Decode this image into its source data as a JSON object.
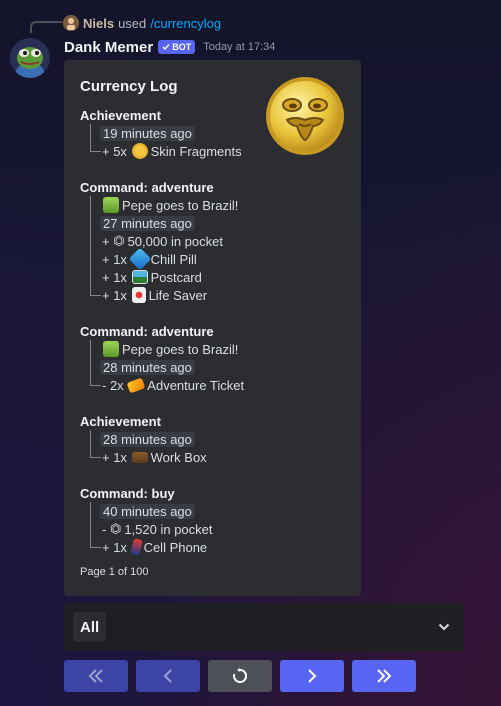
{
  "reply": {
    "user": "Niels",
    "used_text": "used",
    "command": "/currencylog"
  },
  "message": {
    "author": "Dank Memer",
    "badge": "BOT",
    "timestamp": "Today at 17:34"
  },
  "embed": {
    "title": "Currency Log",
    "thumbnail_icon": "pepe-coin-icon",
    "footer": "Page 1 of 100",
    "entries": [
      {
        "title": "Achievement",
        "time": "19 minutes ago",
        "lines": [
          {
            "prefix": "+ 5x",
            "icon": "skin-fragments-icon",
            "text": "Skin Fragments"
          }
        ]
      },
      {
        "title": "Command: adventure",
        "note": {
          "icon": "drink-icon",
          "text": "Pepe goes to Brazil!"
        },
        "time": "27 minutes ago",
        "lines": [
          {
            "prefix": "+",
            "icon": "coin-icon",
            "text": "50,000 in pocket"
          },
          {
            "prefix": "+ 1x",
            "icon": "chill-pill-icon",
            "text": "Chill Pill"
          },
          {
            "prefix": "+ 1x",
            "icon": "postcard-icon",
            "text": "Postcard"
          },
          {
            "prefix": "+ 1x",
            "icon": "life-saver-icon",
            "text": "Life Saver"
          }
        ]
      },
      {
        "title": "Command: adventure",
        "note": {
          "icon": "drink-icon",
          "text": "Pepe goes to Brazil!"
        },
        "time": "28 minutes ago",
        "lines": [
          {
            "prefix": "- 2x",
            "icon": "adventure-ticket-icon",
            "text": "Adventure Ticket"
          }
        ]
      },
      {
        "title": "Achievement",
        "time": "28 minutes ago",
        "lines": [
          {
            "prefix": "+ 1x",
            "icon": "work-box-icon",
            "text": "Work Box"
          }
        ]
      },
      {
        "title": "Command: buy",
        "time": "40 minutes ago",
        "lines": [
          {
            "prefix": "-",
            "icon": "coin-icon",
            "text": "1,520 in pocket"
          },
          {
            "prefix": "+ 1x",
            "icon": "cell-phone-icon",
            "text": "Cell Phone"
          }
        ]
      }
    ]
  },
  "select": {
    "value": "All",
    "icon": "chevron-down-icon"
  },
  "buttons": [
    {
      "name": "first-page-button",
      "icon": "double-chevron-left-icon",
      "style": "disabled"
    },
    {
      "name": "previous-page-button",
      "icon": "chevron-left-icon",
      "style": "disabled"
    },
    {
      "name": "refresh-button",
      "icon": "refresh-icon",
      "style": "secondary"
    },
    {
      "name": "next-page-button",
      "icon": "chevron-right-icon",
      "style": "primary"
    },
    {
      "name": "last-page-button",
      "icon": "double-chevron-right-icon",
      "style": "primary"
    }
  ],
  "colors": {
    "blurple": "#5865f2",
    "blurple_disabled": "#3c45a5",
    "secondary": "#4e5058",
    "embed_bg": "#2b2d31",
    "link": "#00a8fc"
  }
}
